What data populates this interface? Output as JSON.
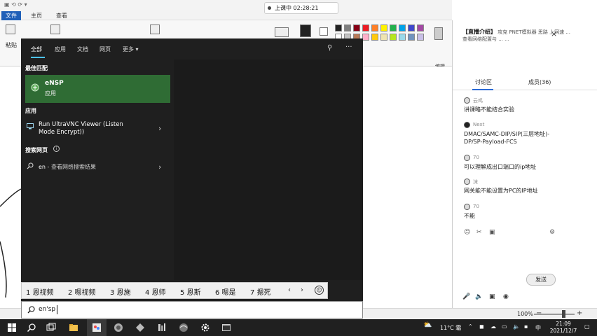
{
  "paint": {
    "tabs": {
      "file": "文件",
      "home": "主页",
      "view": "查看"
    },
    "ribbon": {
      "paste": "粘贴",
      "edit_colors": "编辑颜色"
    },
    "statusbar": {
      "zoom": "100%",
      "zoom_minus": "−",
      "zoom_plus": "+"
    },
    "palette": [
      "#222222",
      "#7f7f7f",
      "#880015",
      "#ed1c24",
      "#ff7f27",
      "#fff200",
      "#22b14c",
      "#00a2e8",
      "#3f48cc",
      "#a349a4",
      "#ffffff",
      "#c3c3c3",
      "#b97a57",
      "#ffaec9",
      "#ffc90e",
      "#efe4b0",
      "#b5e61d",
      "#99d9ea",
      "#7092be",
      "#c8bfe7"
    ]
  },
  "recording": {
    "label": "上课中 02:28:21"
  },
  "live_panel": {
    "header_title": "【直播介绍】",
    "header_text": "攻克 PNET模拟器 思路 上网速 ...\n查看网络配置与 ...\n...",
    "tabs": {
      "discussion": "讨论区",
      "members": "成员(36)"
    },
    "messages": [
      {
        "name": "云鸡",
        "text": "讲课略不能结合实验"
      },
      {
        "name": "Next",
        "text": "DMAC/SAMC-DIP/SIP(三层地址)-DP/SP-Payload-FCS"
      },
      {
        "name": "70",
        "text": "可以理解成出口端口的ip地址"
      },
      {
        "name": "沫",
        "text": "网关能不能设置为PC的IP地址"
      },
      {
        "name": "70",
        "text": "不能"
      }
    ],
    "send": "发送"
  },
  "start_menu": {
    "tabs": [
      "全部",
      "应用",
      "文档",
      "网页",
      "更多"
    ],
    "more_chevron": "▾",
    "best_match_title": "最佳匹配",
    "best_match": {
      "name": "eNSP",
      "type": "应用"
    },
    "apps_title": "应用",
    "app_item": "Run UltraVNC Viewer (Listen Mode Encrypt))",
    "web_title": "搜索网页",
    "web_item_query": "en",
    "web_item_suffix": " - 查看网络搜索结果",
    "chevron": "›"
  },
  "ime": {
    "candidates": [
      "1 恩视频",
      "2 嗯视频",
      "3 恩施",
      "4 恩师",
      "5 恩斯",
      "6 嗯是",
      "7 摁死"
    ],
    "prev": "‹",
    "next": "›",
    "emoji": "☺"
  },
  "search": {
    "value": "en'sp"
  },
  "taskbar": {
    "weather": "11°C 霜",
    "lang": "中",
    "time": "21:09",
    "date": "2021/12/7"
  },
  "colors": {
    "accent": "#4cc2ff",
    "best_match_bg": "#2f6c34",
    "menu_bg": "#1f1f1f",
    "taskbar_bg": "#202020"
  }
}
